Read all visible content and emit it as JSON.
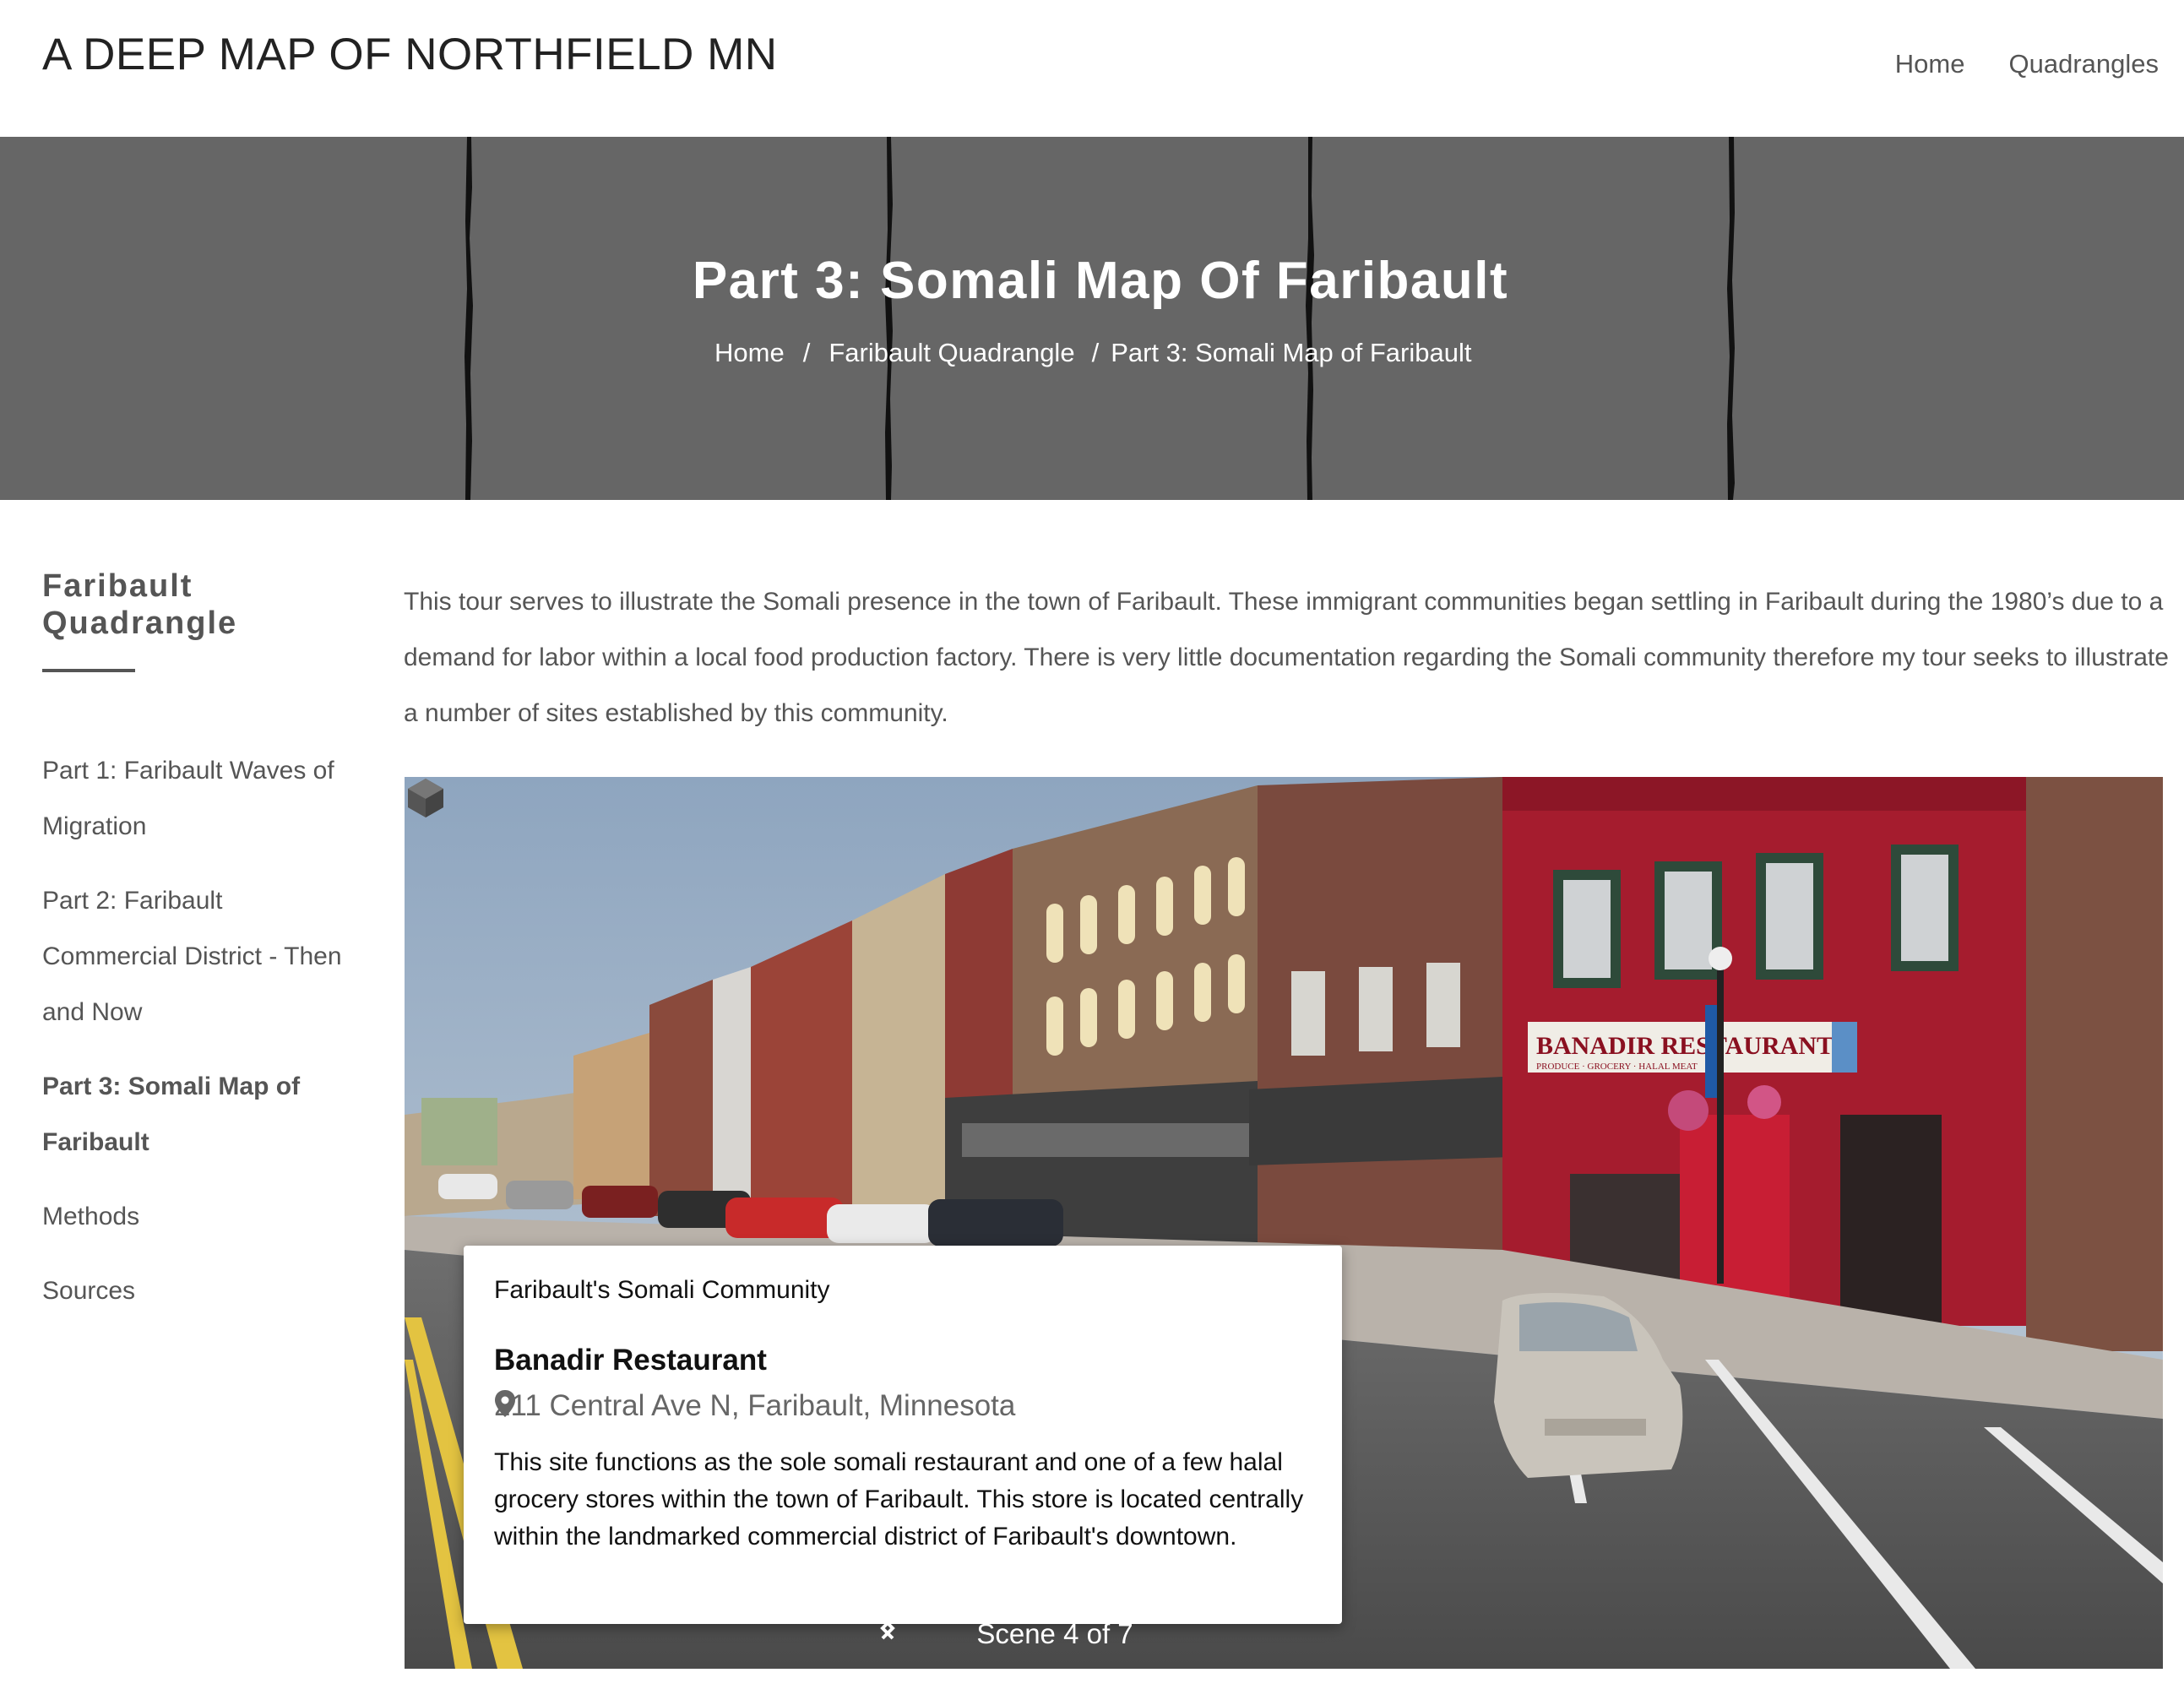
{
  "site": {
    "title": "A DEEP MAP OF NORTHFIELD MN"
  },
  "nav": {
    "items": [
      "Home",
      "Quadrangles"
    ]
  },
  "hero": {
    "title": "Part 3: Somali Map Of Faribault",
    "breadcrumb": [
      "Home",
      "Faribault Quadrangle",
      "Part 3: Somali Map of Faribault"
    ],
    "separator": "/"
  },
  "sidebar": {
    "title": "Faribault Quadrangle",
    "items": [
      "Part 1: Faribault Waves of Migration",
      "Part 2: Faribault Commercial District - Then and Now",
      "Part 3: Somali Map of Faribault",
      "Methods",
      "Sources"
    ]
  },
  "intro": "This tour serves to illustrate the Somali presence in the town of Faribault. These immigrant communities began settling in Faribault during the 1980’s due to a demand for labor within a local food production factory. There is very little documentation regarding the Somali community therefore my tour seeks to illustrate a number of sites established by this community.",
  "scene": {
    "storefront_sign": "BANADIR RESTAURANT",
    "storefront_subsign": "PRODUCE · GROCERY · HALAL MEAT",
    "card": {
      "kicker": "Faribault's Somali Community",
      "name": "Banadir Restaurant",
      "address": "211 Central Ave N, Faribault, Minnesota",
      "description": "This site functions as the sole somali restaurant and one of a few halal grocery stores within the town of Faribault. This store is located centrally within the landmarked commercial district of Faribault's downtown."
    },
    "counter": "Scene 4 of 7"
  },
  "colors": {
    "hero_bg": "#666666",
    "text": "#555555",
    "storefront_red": "#a51c2e"
  },
  "icons": [
    "cube-icon",
    "map-pin-icon",
    "chevron-left-icon",
    "chevron-right-icon"
  ]
}
